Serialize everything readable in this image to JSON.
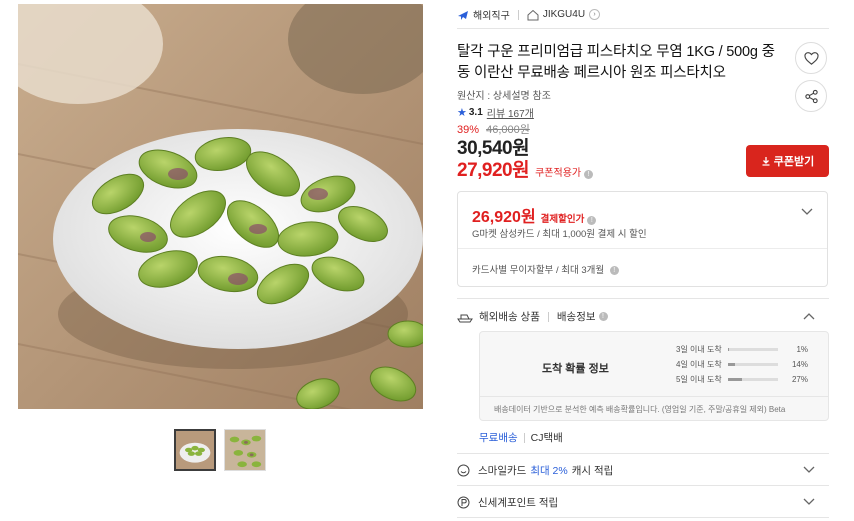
{
  "seller": {
    "badge_label": "해외직구",
    "store_name": "JIKGU4U"
  },
  "product": {
    "title": "탈각 구운 프리미엄급 피스타치오 무염 1KG / 500g 중동 이란산 무료배송 페르시아 원조 피스타치오",
    "origin": "원산지 : 상세설명 참조",
    "rating": "3.1",
    "review_label": "리뷰 167개"
  },
  "price": {
    "discount_rate": "39%",
    "original": "46,000원",
    "sale": "30,540원",
    "coupon": "27,920원",
    "coupon_label": "쿠폰적용가",
    "coupon_button": "쿠폰받기"
  },
  "card_discount": {
    "amount": "26,920원",
    "label": "결제할인가",
    "desc": "G마켓 삼성카드 / 최대 1,000원 결제 시 할인",
    "installment": "카드사별 무이자할부 / 최대 3개월"
  },
  "shipping": {
    "type_label": "해외배송 상품",
    "info_label": "배송정보",
    "prob_title": "도착 확률 정보",
    "rows": [
      {
        "label": "3일 이내 도착",
        "pct": "1%",
        "fill": 0.01
      },
      {
        "label": "4일 이내 도착",
        "pct": "14%",
        "fill": 0.14
      },
      {
        "label": "5일 이내 도착",
        "pct": "27%",
        "fill": 0.27
      }
    ],
    "note": "배송데이터 기반으로 분석한 예측 배송확률입니다. (영업일 기준, 주말/공휴일 제외) Beta",
    "free_label": "무료배송",
    "carrier": "CJ택배"
  },
  "benefits": {
    "smile_prefix": "스마일카드",
    "smile_highlight": "최대 2%",
    "smile_suffix": "캐시 적립",
    "shinsegae": "신세계포인트 적립"
  },
  "colors": {
    "accent_red": "#e02020",
    "button_red": "#d9251d",
    "link_blue": "#2a5fd9"
  }
}
